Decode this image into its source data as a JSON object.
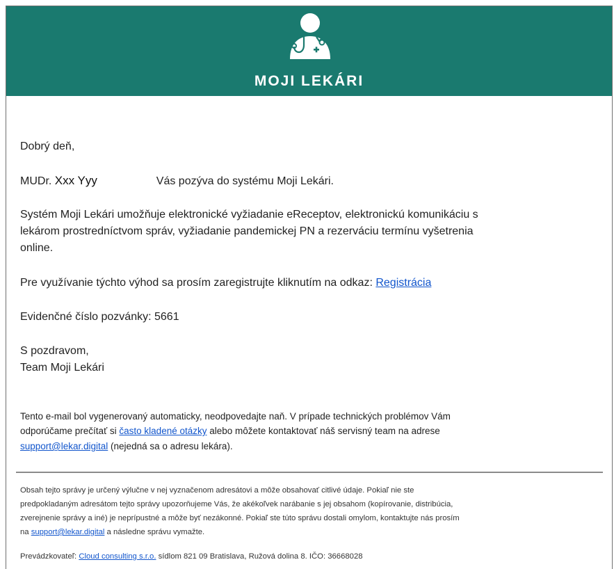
{
  "header": {
    "brand": "MOJI LEKÁRI",
    "background_color": "#1a7a6f",
    "logo_icon": "doctor-stethoscope-icon"
  },
  "body": {
    "greeting": "Dobrý deň,",
    "doctor_prefix": "MUDr.",
    "doctor_name": "Xxx Yyy",
    "invite_text": "Vás pozýva do systému Moji Lekári.",
    "system_line_1": "Systém Moji Lekári umožňuje elektronické vyžiadanie eReceptov, elektronickú komunikáciu s",
    "system_line_2": "lekárom prostredníctvom správ, vyžiadanie pandemickej PN a rezerváciu termínu vyšetrenia",
    "system_line_3": "online.",
    "register_text": "Pre využívanie týchto výhod sa prosím zaregistrujte kliknutím na odkaz:",
    "register_link": "Registrácia",
    "invite_number_label": "Evidenčné číslo pozvánky:",
    "invite_number": "5661",
    "closing": "S pozdravom,",
    "signature": "Team Moji Lekári"
  },
  "notice": {
    "line_1": "Tento e-mail bol vygenerovaný automaticky, neodpovedajte naň. V prípade technických problémov Vám",
    "line_2_pre": "odporúčame prečítať si",
    "faq_link": "často kladené otázky",
    "line_2_post": "alebo môžete kontaktovať náš servisný team na adrese",
    "support_email": "support@lekar.digital",
    "line_3_post": "(nejedná sa o adresu lekára)."
  },
  "disclaimer": {
    "line_1": "Obsah tejto správy je určený výlučne v nej vyznačenom adresátovi a môže obsahovať citlivé údaje. Pokiaľ nie ste",
    "line_2": "predpokladaným adresátom tejto správy upozorňujeme Vás, že akékoľvek narábanie s jej obsahom (kopírovanie, distribúcia,",
    "line_3": "zverejnenie správy a iné) je neprípustné a môže byť nezákonné. Pokiaľ ste túto správu dostali omylom, kontaktujte nás prosím",
    "line_4_pre": "na",
    "support_email": "support@lekar.digital",
    "line_4_post": "a následne správu vymažte.",
    "operator_label": "Prevádzkovateľ:",
    "operator_link": "Cloud consulting s.r.o.",
    "operator_address": "sídlom 821 09 Bratislava, Ružová dolina 8. IČO: 36668028"
  },
  "colors": {
    "link": "#1155cc",
    "divider": "#8a8a8a"
  }
}
